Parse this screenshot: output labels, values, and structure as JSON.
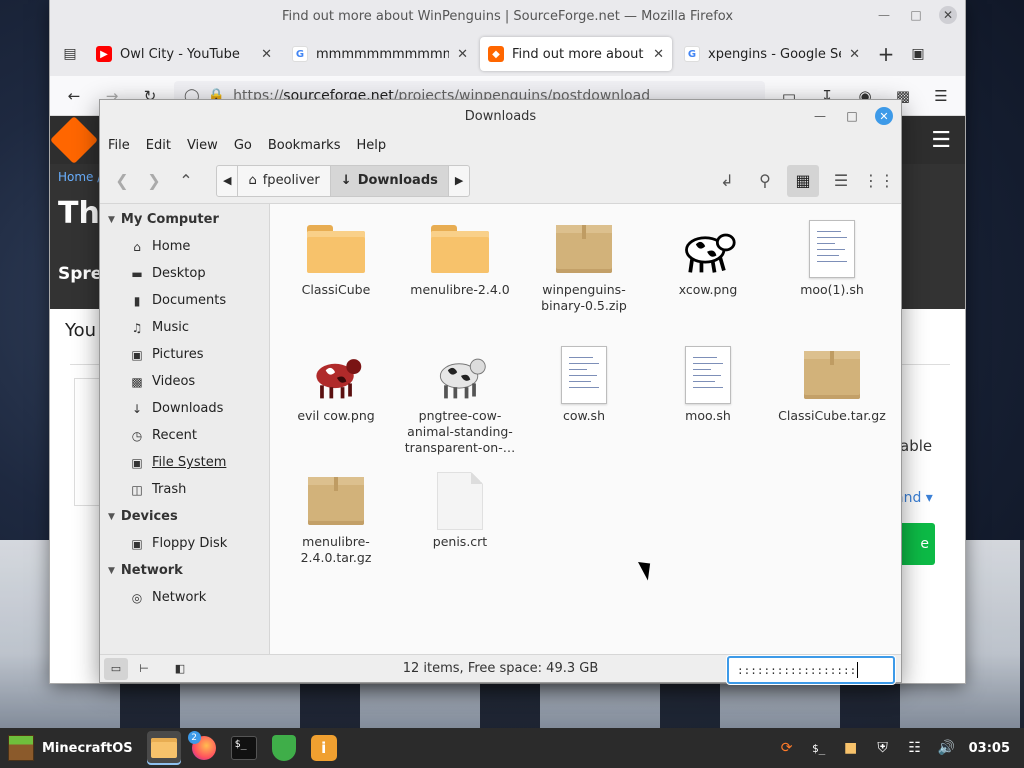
{
  "firefox": {
    "window_title": "Find out more about WinPenguins | SourceForge.net — Mozilla Firefox",
    "tabs": [
      {
        "label": "Owl City - YouTube",
        "icon": "youtube-icon",
        "color": "#ff0000"
      },
      {
        "label": "mmmmmmmmmmmmmmm",
        "icon": "google-icon",
        "color": "#4285f4"
      },
      {
        "label": "Find out more about W",
        "icon": "sourceforge-icon",
        "color": "#ff6600"
      },
      {
        "label": "xpengins - Google Search",
        "icon": "google-icon",
        "color": "#4285f4"
      }
    ],
    "url_scheme": "https://",
    "url_host": "sourceforge.net",
    "url_path": "/projects/winpenguins/postdownload",
    "page": {
      "breadcrumb": "Home /",
      "title_partial": "Tha",
      "spread_partial": "Sprea",
      "you_partial": "You",
      "able_partial": "able",
      "expand_partial": "and ▾",
      "download_partial": "e"
    }
  },
  "nemo": {
    "title": "Downloads",
    "menu": [
      "File",
      "Edit",
      "View",
      "Go",
      "Bookmarks",
      "Help"
    ],
    "breadcrumbs": {
      "home": "fpeoliver",
      "current": "Downloads"
    },
    "sidebar": {
      "my_computer": {
        "header": "My Computer",
        "items": [
          {
            "label": "Home",
            "icon": "home-icon"
          },
          {
            "label": "Desktop",
            "icon": "desktop-icon"
          },
          {
            "label": "Documents",
            "icon": "documents-icon"
          },
          {
            "label": "Music",
            "icon": "music-icon"
          },
          {
            "label": "Pictures",
            "icon": "pictures-icon"
          },
          {
            "label": "Videos",
            "icon": "videos-icon"
          },
          {
            "label": "Downloads",
            "icon": "downloads-icon"
          },
          {
            "label": "Recent",
            "icon": "recent-icon"
          },
          {
            "label": "File System",
            "icon": "filesystem-icon"
          },
          {
            "label": "Trash",
            "icon": "trash-icon"
          }
        ]
      },
      "devices": {
        "header": "Devices",
        "items": [
          {
            "label": "Floppy Disk",
            "icon": "floppy-icon"
          }
        ]
      },
      "network": {
        "header": "Network",
        "items": [
          {
            "label": "Network",
            "icon": "network-icon"
          }
        ]
      }
    },
    "files": [
      {
        "name": "ClassiCube",
        "type": "folder"
      },
      {
        "name": "menulibre-2.4.0",
        "type": "folder"
      },
      {
        "name": "winpenguins-binary-0.5.zip",
        "type": "archive"
      },
      {
        "name": "xcow.png",
        "type": "image"
      },
      {
        "name": "moo(1).sh",
        "type": "script"
      },
      {
        "name": "evil cow.png",
        "type": "image"
      },
      {
        "name": "pngtree-cow-animal-standing-transparent-on-…",
        "type": "image"
      },
      {
        "name": "cow.sh",
        "type": "script"
      },
      {
        "name": "moo.sh",
        "type": "script"
      },
      {
        "name": "ClassiCube.tar.gz",
        "type": "archive"
      },
      {
        "name": "menulibre-2.4.0.tar.gz",
        "type": "archive"
      },
      {
        "name": "penis.crt",
        "type": "certificate"
      }
    ],
    "status": "12 items, Free space: 49.3 GB",
    "rename_value": "::::::::::::::::::"
  },
  "taskbar": {
    "menu_label": "MinecraftOS",
    "firefox_badge": "2",
    "clock": "03:05"
  }
}
